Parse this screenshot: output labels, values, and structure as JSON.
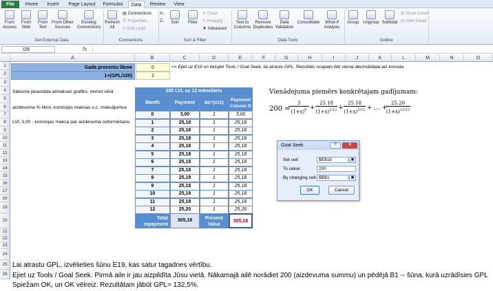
{
  "ribbon": {
    "tabs": [
      "File",
      "Home",
      "Insert",
      "Page Layout",
      "Formulas",
      "Data",
      "Review",
      "View"
    ],
    "buttons": {
      "from_access": "From Access",
      "from_web": "From Web",
      "from_text": "From Text",
      "from_other": "From Other Sources",
      "existing": "Existing Connections",
      "refresh": "Refresh All",
      "connections": "Connections",
      "properties": "Properties",
      "edit_links": "Edit Links",
      "sort": "Sort",
      "filter": "Filter",
      "clear": "Clear",
      "reapply": "Reapply",
      "advanced": "Advanced",
      "text_to_columns": "Text to Columns",
      "remove_duplicates": "Remove Duplicates",
      "data_validation": "Data Validation",
      "consolidate": "Consolidate",
      "what_if": "What-If Analysis",
      "group": "Group",
      "ungroup": "Ungroup",
      "subtotal": "Subtotal",
      "show_detail": "Show Detail",
      "hide_detail": "Hide Detail"
    },
    "groups": {
      "external": "Get External Data",
      "connections": "Connections",
      "sort_filter": "Sort & Filter",
      "data_tools": "Data Tools",
      "outline": "Outline"
    }
  },
  "formula_bar": {
    "name_box": "I29",
    "fx": "fx"
  },
  "columns": [
    "A",
    "B",
    "C",
    "D",
    "E",
    "F",
    "G",
    "H",
    "I",
    "J",
    "K",
    "L",
    "M",
    "N",
    "O"
  ],
  "rows": [
    "1",
    "2",
    "3",
    "4",
    "5",
    "6",
    "7",
    "8",
    "9",
    "10",
    "11",
    "12",
    "13",
    "14",
    "15",
    "16",
    "17",
    "18",
    "19",
    "20",
    "21",
    "22",
    "23",
    "24",
    "25",
    "26"
  ],
  "cells": {
    "a1": "Gada procentu likme",
    "b1": "0",
    "c1": "<< Ejiet uz E19 un lietojiet Tools / Goal Seek, lai atrastu GPL. Rezultātu noapaļo līdz vienai decimāldaļai aiz komata.",
    "a2": "1+(GPL/100)",
    "b2": "1",
    "a4": "Sākumā jāsastāda atmaksas grafiks, ņemot vērā",
    "a5": "aizdevuma % likmi, komisijas maksas u.c. maksājumus",
    "a7": "LVL 3,00 - komisijas maksa par aizdevuma noformēšanu"
  },
  "table": {
    "title": "200 LVL uz 12 mēnešiem",
    "headers": [
      "Month",
      "Payment",
      "B2^(t/12)",
      "Payment/ Column D"
    ],
    "rows": [
      [
        "0",
        "3,00",
        "1",
        "3,00"
      ],
      [
        "1",
        "25,18",
        "1",
        "25,18"
      ],
      [
        "2",
        "25,18",
        "1",
        "25,18"
      ],
      [
        "3",
        "25,18",
        "1",
        "25,18"
      ],
      [
        "4",
        "25,18",
        "1",
        "25,18"
      ],
      [
        "5",
        "25,18",
        "1",
        "25,18"
      ],
      [
        "6",
        "25,18",
        "1",
        "25,18"
      ],
      [
        "7",
        "25,18",
        "1",
        "25,18"
      ],
      [
        "8",
        "25,18",
        "1",
        "25,18"
      ],
      [
        "9",
        "25,18",
        "1",
        "25,18"
      ],
      [
        "10",
        "25,18",
        "1",
        "25,18"
      ],
      [
        "11",
        "25,18",
        "1",
        "25,18"
      ],
      [
        "12",
        "25,20",
        "1",
        "25,20"
      ]
    ],
    "total_label": "Total repayment",
    "total_value": "305,18",
    "pv_label": "Present Value",
    "pv_value": "305,18"
  },
  "equation": {
    "title": "Vienādojuma piemērs konkrētajam gadījumam:",
    "lhs": "200 =",
    "t1n": "3",
    "t1d": "(1+x)",
    "t1e": "0",
    "t2n": "25.18",
    "t2d": "(1+x)",
    "t2e": "1/12",
    "t3n": "25.18",
    "t3d": "(1+x)",
    "t3e": "2/12",
    "dots": "+ ... +",
    "t4n": "25.20",
    "t4d": "(1+x)",
    "t4e": "12/12"
  },
  "dialog": {
    "title": "Goal Seek",
    "help": "?",
    "set_cell_label": "Set cell:",
    "set_cell_value": "$E$19",
    "to_value_label": "To value:",
    "to_value_value": "200",
    "changing_label": "By changing cell:",
    "changing_value": "$B$1",
    "ok": "OK",
    "cancel": "Cancel"
  },
  "notes": [
    "Lai atrastu GPL, izvēlieties šūnu E19, kas satur tagadnes vērtību.",
    "Ejiet uz Tools / Goal Seek. Pirmā aile ir jau aizpildīta Jūsu vietā. Nākamajā ailē norādiet 200 (aizdevuma summu) un pēdējā B1 -- šūna, kurā uzrādīsies GPL",
    "Spiežam OK, un OK vēlreiz. Rezultātam jābūt GPL= 132,5%."
  ]
}
